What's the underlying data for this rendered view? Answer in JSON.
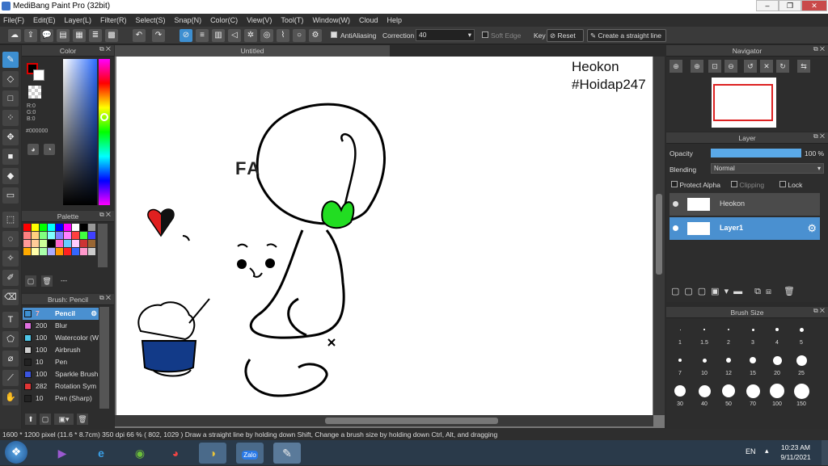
{
  "app": {
    "title": "MediBang Paint Pro (32bit)"
  },
  "menu": [
    "File(F)",
    "Edit(E)",
    "Layer(L)",
    "Filter(R)",
    "Select(S)",
    "Snap(N)",
    "Color(C)",
    "View(V)",
    "Tool(T)",
    "Window(W)",
    "Cloud",
    "Help"
  ],
  "toolbar": {
    "antialiasing_label": "AntiAliasing",
    "correction_label": "Correction",
    "correction_value": "40",
    "soft_edge_label": "Soft Edge",
    "key_label": "Key",
    "reset_label": "Reset",
    "straight_line_label": "Create a straight line"
  },
  "color_panel": {
    "title": "Color",
    "r": "R:0",
    "g": "G:0",
    "b": "B:0",
    "hex": "#000000"
  },
  "palette_panel": {
    "title": "Palette",
    "footer_text": "---"
  },
  "brush_panel": {
    "title": "Brush: Pencil",
    "items": [
      {
        "size": "7",
        "name": "Pencil",
        "color": "#3d8fd1"
      },
      {
        "size": "200",
        "name": "Blur",
        "color": "#e070e0"
      },
      {
        "size": "100",
        "name": "Watercolor (W",
        "color": "#4fc7e8"
      },
      {
        "size": "100",
        "name": "Airbrush",
        "color": "#cfcfcf"
      },
      {
        "size": "10",
        "name": "Pen",
        "color": "#222222"
      },
      {
        "size": "100",
        "name": "Sparkle Brush",
        "color": "#3a54e0"
      },
      {
        "size": "282",
        "name": "Rotation Sym",
        "color": "#e03535"
      },
      {
        "size": "10",
        "name": "Pen (Sharp)",
        "color": "#222222"
      }
    ]
  },
  "canvas": {
    "tab_title": "Untitled",
    "text_line1": "Heokon",
    "text_line2": "#Hoidap247",
    "drawing_text": "FA"
  },
  "navigator": {
    "title": "Navigator"
  },
  "layer_panel": {
    "title": "Layer",
    "opacity_label": "Opacity",
    "opacity_value": "100 %",
    "opacity_fraction": 1.0,
    "blending_label": "Blending",
    "blending_value": "Normal",
    "protect_alpha": "Protect Alpha",
    "clipping": "Clipping",
    "lock": "Lock",
    "layers": [
      {
        "name": "Heokon",
        "selected": false
      },
      {
        "name": "Layer1",
        "selected": true
      }
    ]
  },
  "brush_size": {
    "title": "Brush Size",
    "sizes": [
      "1",
      "1.5",
      "2",
      "3",
      "4",
      "5",
      "7",
      "10",
      "12",
      "15",
      "20",
      "25",
      "30",
      "40",
      "50",
      "70",
      "100",
      "150"
    ]
  },
  "status_bar": {
    "text": "1600 * 1200 pixel   (11.6 * 8.7cm)   350 dpi   66 %   ( 802, 1029 )   Draw a straight line by holding down Shift, Change a brush size by holding down Ctrl, Alt, and dragging"
  },
  "taskbar": {
    "lang": "EN",
    "time": "10:23 AM",
    "date": "9/11/2021",
    "zalo_label": "Zalo"
  },
  "colors": {
    "accent": "#3d8fd1",
    "leaf": "#22dd22",
    "heart_red": "#e02020",
    "pot_blue": "#123a88"
  }
}
